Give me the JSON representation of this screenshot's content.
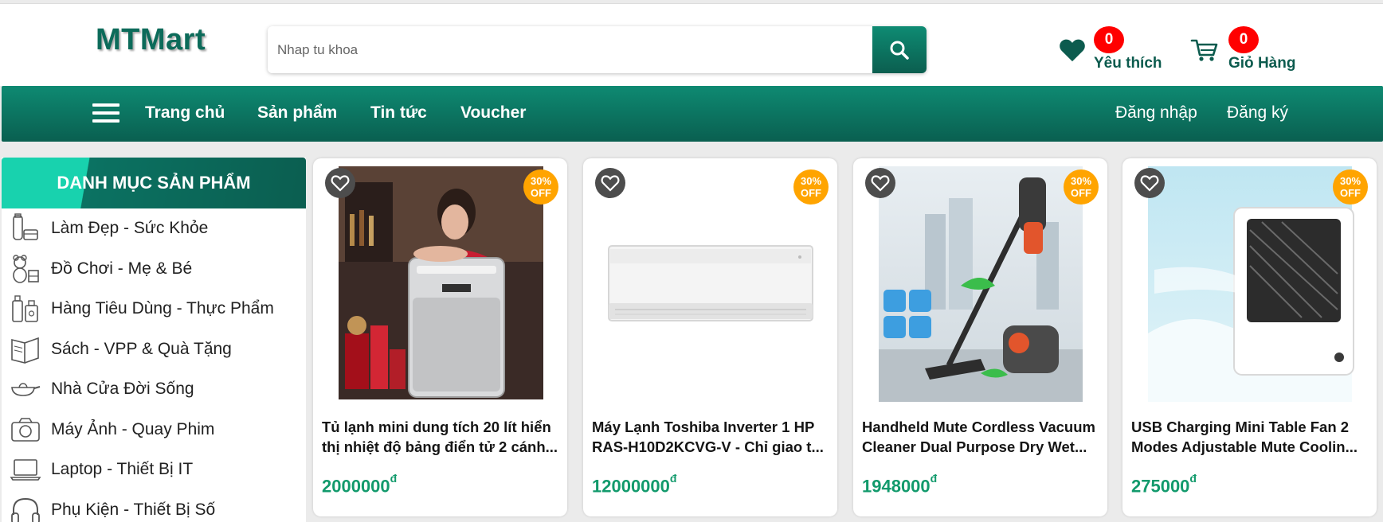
{
  "header": {
    "logo": "MTMart",
    "search": {
      "placeholder": "Nhap tu khoa",
      "value": ""
    },
    "favorites": {
      "label": "Yêu thích",
      "count": "0"
    },
    "cart": {
      "label": "Giỏ Hàng",
      "count": "0"
    }
  },
  "nav": {
    "items": [
      {
        "label": "Trang chủ"
      },
      {
        "label": "Sản phẩm"
      },
      {
        "label": "Tin tức"
      },
      {
        "label": "Voucher"
      }
    ],
    "login": "Đăng nhập",
    "register": "Đăng ký"
  },
  "sidebar": {
    "title": "DANH MỤC SẢN PHẨM",
    "items": [
      {
        "label": "Làm Đẹp - Sức Khỏe",
        "icon": "cosmetics-icon"
      },
      {
        "label": "Đồ Chơi - Mẹ & Bé",
        "icon": "teddy-bear-icon"
      },
      {
        "label": "Hàng Tiêu Dùng - Thực Phẩm",
        "icon": "grocery-icon"
      },
      {
        "label": "Sách - VPP & Quà Tặng",
        "icon": "book-icon"
      },
      {
        "label": "Nhà Cửa Đời Sống",
        "icon": "pan-icon"
      },
      {
        "label": "Máy Ảnh - Quay Phim",
        "icon": "camera-icon"
      },
      {
        "label": "Laptop - Thiết Bị IT",
        "icon": "laptop-icon"
      },
      {
        "label": "Phụ Kiện - Thiết Bị Số",
        "icon": "headphones-icon"
      }
    ]
  },
  "products": [
    {
      "title": "Tủ lạnh mini dung tích 20 lít hiển thị nhiệt độ bảng điển tử 2 cánh...",
      "price": "2000000",
      "currency": "đ",
      "discount": "30%",
      "discount_label": "OFF"
    },
    {
      "title": "Máy Lạnh Toshiba Inverter 1 HP RAS-H10D2KCVG-V - Chỉ giao t...",
      "price": "12000000",
      "currency": "đ",
      "discount": "30%",
      "discount_label": "OFF"
    },
    {
      "title": "Handheld Mute Cordless Vacuum Cleaner Dual Purpose Dry Wet...",
      "price": "1948000",
      "currency": "đ",
      "discount": "30%",
      "discount_label": "OFF"
    },
    {
      "title": "USB Charging Mini Table Fan 2 Modes Adjustable Mute Coolin...",
      "price": "275000",
      "currency": "đ",
      "discount": "30%",
      "discount_label": "OFF"
    }
  ],
  "colors": {
    "brand": "#0c6b5a",
    "nav_bg": "#0b705f",
    "badge": "#ff0000",
    "discount": "#ffa400",
    "price": "#129a6c"
  }
}
